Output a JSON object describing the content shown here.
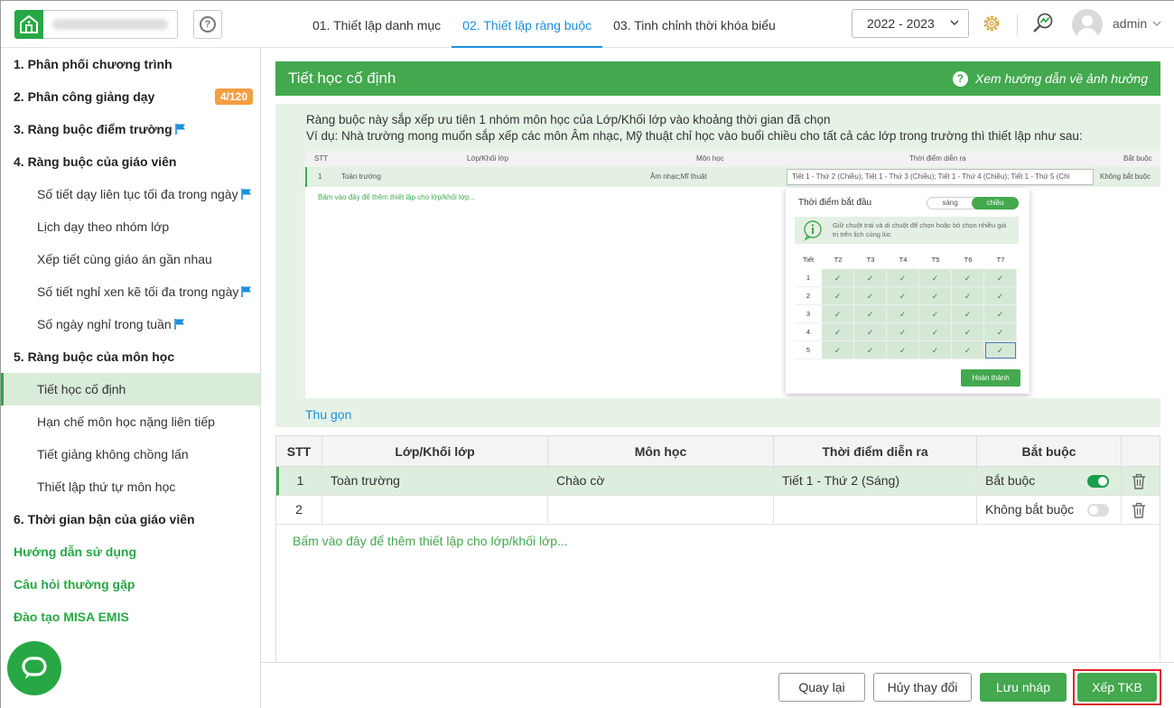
{
  "header": {
    "steps": [
      {
        "label": "01. Thiết lập danh mục"
      },
      {
        "label": "02. Thiết lập ràng buộc"
      },
      {
        "label": "03. Tinh chỉnh thời khóa biểu"
      }
    ],
    "school_year": "2022 - 2023",
    "username": "admin"
  },
  "sidebar": {
    "items": [
      {
        "label": "1. Phân phối chương trình"
      },
      {
        "label": "2. Phân công giảng dạy",
        "badge": "4/120"
      },
      {
        "label": "3. Ràng buộc điểm trường"
      },
      {
        "label": "4. Ràng buộc của giáo viên"
      },
      {
        "label": "Số tiết dạy liên tục tối đa trong ngày"
      },
      {
        "label": "Lịch dạy theo nhóm lớp"
      },
      {
        "label": "Xếp tiết cùng giáo án gần nhau"
      },
      {
        "label": "Số tiết nghỉ xen kẽ tối đa trong ngày"
      },
      {
        "label": "Số ngày nghỉ trong tuần"
      },
      {
        "label": "5. Ràng buộc của môn học"
      },
      {
        "label": "Tiết học cố định"
      },
      {
        "label": "Hạn chế môn học nặng liên tiếp"
      },
      {
        "label": "Tiết giảng không chồng lấn"
      },
      {
        "label": "Thiết lập thứ tự môn học"
      },
      {
        "label": "6. Thời gian bận của giáo viên"
      },
      {
        "label": "Hướng dẫn sử dụng"
      },
      {
        "label": "Câu hỏi thường gặp"
      },
      {
        "label": "Đào tạo MISA EMIS"
      }
    ]
  },
  "main": {
    "title": "Tiết học cố định",
    "guide_link": "Xem hướng dẫn về ảnh hưởng",
    "description_1": "Ràng buộc này sắp xếp ưu tiên 1 nhóm môn học của Lớp/Khối lớp vào khoảng thời gian đã chọn",
    "description_2": "Ví dụ: Nhà trường mong muốn sắp xếp các môn Âm nhạc, Mỹ thuật chỉ học vào buổi chiều cho tất cả các lớp trong trường thì thiết lập như sau:",
    "example": {
      "headers": [
        "STT",
        "Lớp/Khối lớp",
        "Môn học",
        "Thời điểm diễn ra",
        "Bắt buộc"
      ],
      "row": {
        "stt": "1",
        "class": "Toàn trường",
        "subject": "Âm nhạc;Mĩ thuật",
        "time": "Tiết 1 - Thứ 2 (Chiều); Tiết 1 - Thứ 3 (Chiều); Tiết 1 - Thứ 4 (Chiều); Tiết 1 - Thứ 5 (Chi",
        "required": "Không bắt buộc"
      },
      "add_link": "Bấm vào đây để thêm thiết lập cho lớp/khối lớp...",
      "popup": {
        "title": "Thời điểm bắt đầu",
        "seg_morning": "sáng",
        "seg_afternoon": "chiều",
        "hint": "Giữ chuột trái và di chuột để chọn hoặc bỏ chọn nhiều giá trị trên lịch cùng lúc",
        "col_header": "Tiết",
        "days": [
          "T2",
          "T3",
          "T4",
          "T5",
          "T6",
          "T7"
        ],
        "periods": [
          "1",
          "2",
          "3",
          "4",
          "5"
        ],
        "check": "✓",
        "done": "Hoàn thành"
      }
    },
    "collapse": "Thu gọn",
    "table": {
      "headers": [
        "STT",
        "Lớp/Khối lớp",
        "Môn học",
        "Thời điểm diễn ra",
        "Bắt buộc"
      ],
      "rows": [
        {
          "stt": "1",
          "class": "Toàn trường",
          "subject": "Chào cờ",
          "time": "Tiết 1 - Thứ 2 (Sáng)",
          "required": "Bắt buộc",
          "on": true
        },
        {
          "stt": "2",
          "class": "",
          "subject": "",
          "time": "",
          "required": "Không bắt buộc",
          "on": false
        }
      ],
      "add_link": "Bấm vào đây để thêm thiết lập cho lớp/khối lớp..."
    }
  },
  "footer": {
    "back": "Quay lại",
    "cancel": "Hủy thay đổi",
    "save_draft": "Lưu nháp",
    "schedule": "Xếp TKB"
  },
  "colors": {
    "brand_green": "#43a84e",
    "link_blue": "#1a8fdd",
    "badge_orange": "#f59e42",
    "highlight_red": "#e0262b"
  }
}
